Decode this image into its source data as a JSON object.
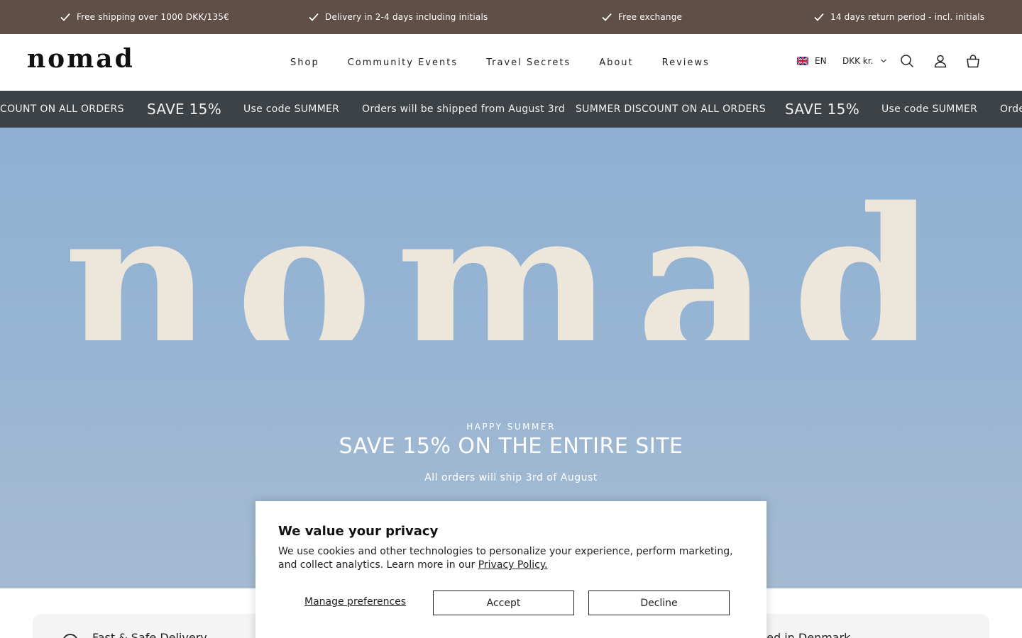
{
  "announcement_bar": {
    "items": [
      "Free shipping over 1000 DKK/135€",
      "Delivery in 2-4 days including initials",
      "Free exchange",
      "14 days return period - incl. initials"
    ],
    "icon": "checkmark-icon"
  },
  "header": {
    "logo": "nomad",
    "nav": [
      "Shop",
      "Community Events",
      "Travel Secrets",
      "About",
      "Reviews"
    ],
    "language": "EN",
    "currency": "DKK kr.",
    "icons": [
      "uk-flag-icon",
      "chevron-down-icon",
      "search-icon",
      "account-icon",
      "cart-icon"
    ]
  },
  "marquee": {
    "items": [
      "COUNT ON ALL ORDERS",
      "SAVE 15%",
      "Use code SUMMER",
      "Orders will be shipped from August 3rd",
      "SUMMER DISCOUNT ON ALL ORDERS",
      "SAVE 15%",
      "Use code SUMMER",
      "Orde"
    ]
  },
  "hero": {
    "logo_text": "nomad",
    "eyebrow": "HAPPY SUMMER",
    "title": "SAVE 15% ON THE ENTIRE SITE",
    "subtitle": "All orders will ship 3rd of August"
  },
  "features": {
    "left": "Fast & Safe Delivery",
    "right": "ned in Denmark"
  },
  "cookie": {
    "title": "We value your privacy",
    "text": "We use cookies and other technologies to personalize your experience, perform marketing, and collect analytics. Learn more in our",
    "privacy_link": "Privacy Policy.",
    "manage": "Manage preferences",
    "accept": "Accept",
    "decline": "Decline"
  },
  "colors": {
    "announcement_bg": "#5f4f47",
    "marquee_bg": "#3d4247",
    "hero_sky": "#97b4d3",
    "hero_logo": "#ede6db"
  }
}
